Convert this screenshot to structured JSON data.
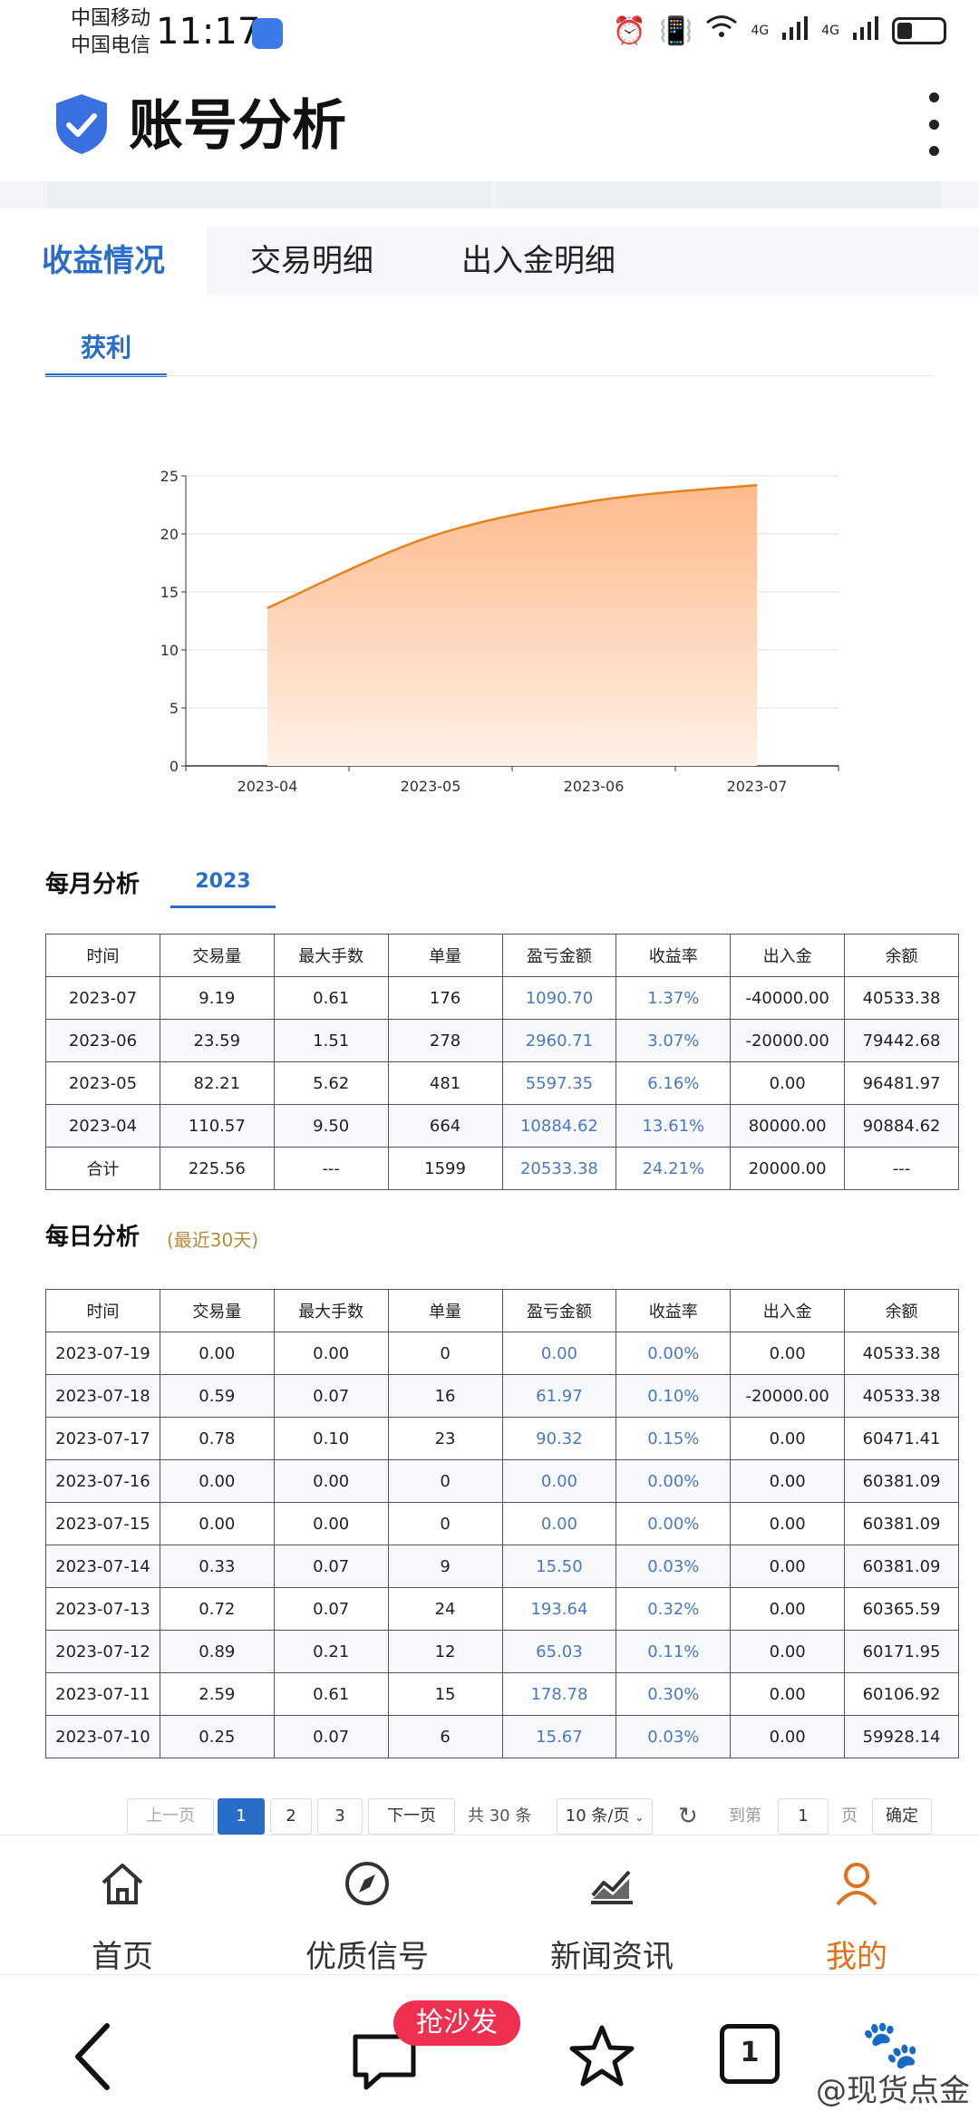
{
  "status_bar": {
    "carrier_1": "中国移动",
    "carrier_2": "中国电信",
    "time": "11:17",
    "net_label_1": "4G",
    "net_label_2": "4G"
  },
  "header": {
    "title": "账号分析"
  },
  "tabs": [
    {
      "label": "收益情况",
      "active": true
    },
    {
      "label": "交易明细",
      "active": false
    },
    {
      "label": "出入金明细",
      "active": false
    }
  ],
  "sub_tab": {
    "label": "获利"
  },
  "chart_data": {
    "type": "area",
    "categories": [
      "2023-04",
      "2023-05",
      "2023-06",
      "2023-07"
    ],
    "series": [
      {
        "values": [
          13.61,
          19.77,
          22.84,
          24.21
        ]
      }
    ],
    "ylim": [
      0,
      25
    ],
    "yticks": [
      0,
      5,
      10,
      15,
      20,
      25
    ],
    "grid": true,
    "colors": {
      "line": "#e6821e",
      "fill_top": "#fdba8c",
      "fill_bottom": "#fff1e6"
    }
  },
  "monthly": {
    "title": "每月分析",
    "year": "2023",
    "headers": [
      "时间",
      "交易量",
      "最大手数",
      "单量",
      "盈亏金额",
      "收益率",
      "出入金",
      "余额"
    ],
    "rows": [
      [
        "2023-07",
        "9.19",
        "0.61",
        "176",
        "1090.70",
        "1.37%",
        "-40000.00",
        "40533.38"
      ],
      [
        "2023-06",
        "23.59",
        "1.51",
        "278",
        "2960.71",
        "3.07%",
        "-20000.00",
        "79442.68"
      ],
      [
        "2023-05",
        "82.21",
        "5.62",
        "481",
        "5597.35",
        "6.16%",
        "0.00",
        "96481.97"
      ],
      [
        "2023-04",
        "110.57",
        "9.50",
        "664",
        "10884.62",
        "13.61%",
        "80000.00",
        "90884.62"
      ],
      [
        "合计",
        "225.56",
        "---",
        "1599",
        "20533.38",
        "24.21%",
        "20000.00",
        "---"
      ]
    ]
  },
  "daily": {
    "title": "每日分析",
    "note": "(最近30天)",
    "headers": [
      "时间",
      "交易量",
      "最大手数",
      "单量",
      "盈亏金额",
      "收益率",
      "出入金",
      "余额"
    ],
    "rows": [
      [
        "2023-07-19",
        "0.00",
        "0.00",
        "0",
        "0.00",
        "0.00%",
        "0.00",
        "40533.38"
      ],
      [
        "2023-07-18",
        "0.59",
        "0.07",
        "16",
        "61.97",
        "0.10%",
        "-20000.00",
        "40533.38"
      ],
      [
        "2023-07-17",
        "0.78",
        "0.10",
        "23",
        "90.32",
        "0.15%",
        "0.00",
        "60471.41"
      ],
      [
        "2023-07-16",
        "0.00",
        "0.00",
        "0",
        "0.00",
        "0.00%",
        "0.00",
        "60381.09"
      ],
      [
        "2023-07-15",
        "0.00",
        "0.00",
        "0",
        "0.00",
        "0.00%",
        "0.00",
        "60381.09"
      ],
      [
        "2023-07-14",
        "0.33",
        "0.07",
        "9",
        "15.50",
        "0.03%",
        "0.00",
        "60381.09"
      ],
      [
        "2023-07-13",
        "0.72",
        "0.07",
        "24",
        "193.64",
        "0.32%",
        "0.00",
        "60365.59"
      ],
      [
        "2023-07-12",
        "0.89",
        "0.21",
        "12",
        "65.03",
        "0.11%",
        "0.00",
        "60171.95"
      ],
      [
        "2023-07-11",
        "2.59",
        "0.61",
        "15",
        "178.78",
        "0.30%",
        "0.00",
        "60106.92"
      ],
      [
        "2023-07-10",
        "0.25",
        "0.07",
        "6",
        "15.67",
        "0.03%",
        "0.00",
        "59928.14"
      ]
    ]
  },
  "pagination": {
    "prev": "上一页",
    "pages": [
      "1",
      "2",
      "3"
    ],
    "current_page": "1",
    "next": "下一页",
    "total": "共 30 条",
    "page_size": "10 条/页",
    "goto_label": "到第",
    "goto_value": "1",
    "page_unit": "页",
    "confirm": "确定"
  },
  "bottom_nav": [
    {
      "label": "首页",
      "icon": "home-icon",
      "active": false
    },
    {
      "label": "优质信号",
      "icon": "compass-icon",
      "active": false
    },
    {
      "label": "新闻资讯",
      "icon": "trend-chart-icon",
      "active": false
    },
    {
      "label": "我的",
      "icon": "user-icon",
      "active": true
    }
  ],
  "system_bar": {
    "badge": "抢沙发",
    "tab_count": "1",
    "watermark": "@现货点金"
  }
}
